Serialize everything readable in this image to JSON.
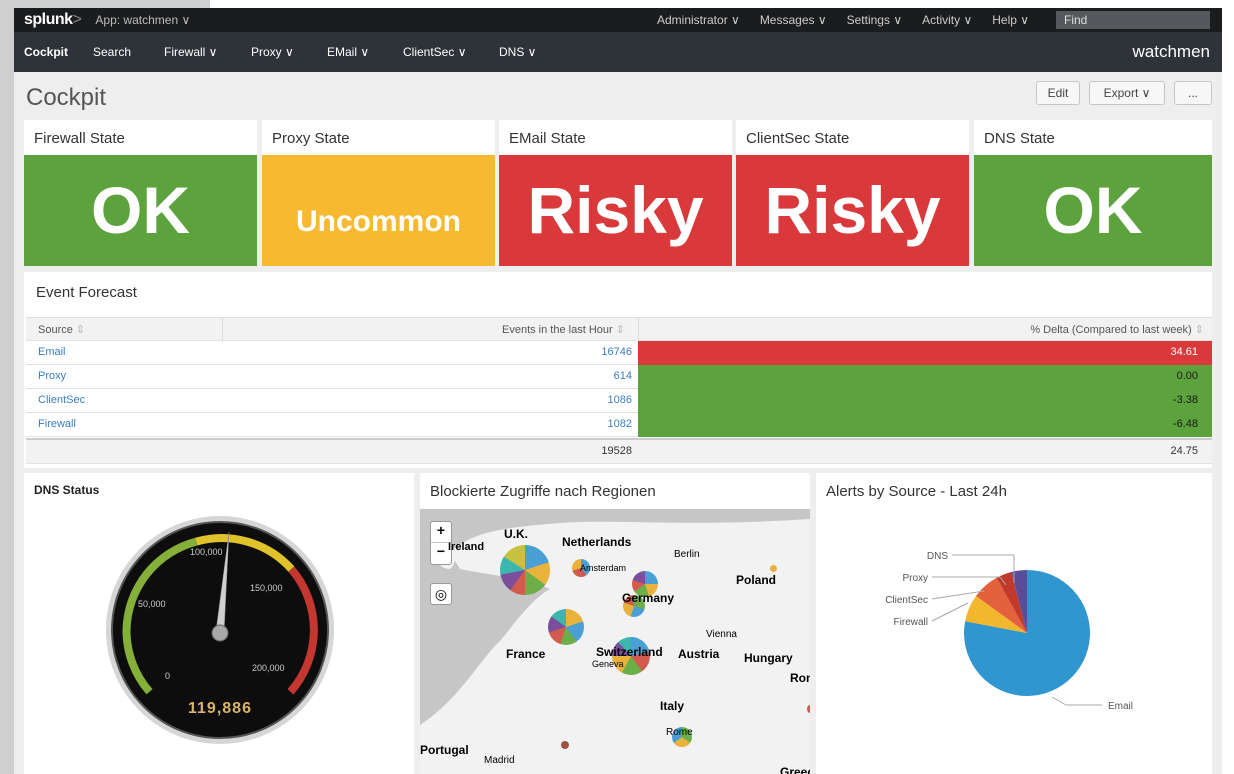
{
  "topbar": {
    "logo": "splunk",
    "logo_suffix": ">",
    "app_label": "App: watchmen ∨",
    "menu": [
      "Administrator ∨",
      "Messages ∨",
      "Settings ∨",
      "Activity ∨",
      "Help ∨"
    ],
    "find_placeholder": "Find"
  },
  "navbar": {
    "items": [
      "Cockpit",
      "Search",
      "Firewall ∨",
      "Proxy ∨",
      "EMail ∨",
      "ClientSec ∨",
      "DNS ∨"
    ],
    "app_title": "watchmen"
  },
  "page": {
    "title": "Cockpit",
    "edit_label": "Edit",
    "export_label": "Export ∨",
    "more_label": "..."
  },
  "states": [
    {
      "title": "Firewall State",
      "value": "OK",
      "color": "#5ca23d"
    },
    {
      "title": "Proxy State",
      "value": "Uncommon",
      "color": "#f6b930"
    },
    {
      "title": "EMail State",
      "value": "Risky",
      "color": "#d9393a"
    },
    {
      "title": "ClientSec State",
      "value": "Risky",
      "color": "#d9393a"
    },
    {
      "title": "DNS State",
      "value": "OK",
      "color": "#5ca23d"
    }
  ],
  "forecast": {
    "title": "Event Forecast",
    "columns": [
      "Source",
      "Events in the last Hour",
      "% Delta (Compared to last week)"
    ],
    "sort_glyph": "⇕",
    "rows": [
      {
        "source": "Email",
        "events": "16746",
        "delta": "34.61",
        "color": "#d9393a"
      },
      {
        "source": "Proxy",
        "events": "614",
        "delta": "0.00",
        "color": "#5ca23d"
      },
      {
        "source": "ClientSec",
        "events": "1086",
        "delta": "-3.38",
        "color": "#5ca23d"
      },
      {
        "source": "Firewall",
        "events": "1082",
        "delta": "-6.48",
        "color": "#5ca23d"
      }
    ],
    "total_events": "19528",
    "total_delta": "24.75"
  },
  "dns": {
    "title": "DNS Status",
    "value": "119,886",
    "ticks": [
      "0",
      "50,000",
      "100,000",
      "150,000",
      "200,000"
    ]
  },
  "map": {
    "title": "Blockierte Zugriffe nach Regionen",
    "zoom_in": "+",
    "zoom_out": "−",
    "labels": [
      "U.K.",
      "Ireland",
      "Netherlands",
      "Berlin",
      "Amsterdam",
      "Poland",
      "Germany",
      "France",
      "Switzerland",
      "Austria",
      "Vienna",
      "Hungary",
      "Geneva",
      "Rom",
      "Italy",
      "Rome",
      "Portugal",
      "Madrid",
      "Greece"
    ]
  },
  "alerts": {
    "title": "Alerts by Source - Last 24h",
    "labels": [
      "DNS",
      "Proxy",
      "ClientSec",
      "Firewall",
      "Email"
    ]
  }
}
